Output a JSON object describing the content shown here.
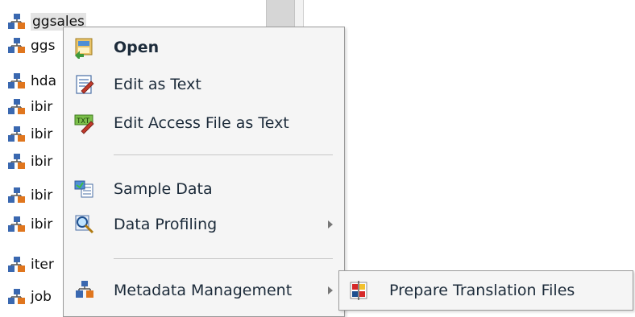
{
  "tree": {
    "items": [
      {
        "label": "ggsales",
        "selected": true
      },
      {
        "label": "ggs"
      },
      {
        "label": "hda"
      },
      {
        "label": "ibir"
      },
      {
        "label": "ibir"
      },
      {
        "label": "ibir"
      },
      {
        "label": "ibir"
      },
      {
        "label": "ibir"
      },
      {
        "label": "iter"
      },
      {
        "label": "job"
      }
    ]
  },
  "context_menu": {
    "items": [
      {
        "label": "Open",
        "icon": "open-icon",
        "bold": true
      },
      {
        "label": "Edit as Text",
        "icon": "edit-text-icon"
      },
      {
        "label": "Edit Access File as Text",
        "icon": "edit-access-file-icon"
      },
      {
        "label": "Sample Data",
        "icon": "sample-data-icon"
      },
      {
        "label": "Data Profiling",
        "icon": "data-profiling-icon",
        "has_submenu": true
      },
      {
        "label": "Metadata Management",
        "icon": "metadata-icon",
        "has_submenu": true
      }
    ]
  },
  "submenu": {
    "items": [
      {
        "label": "Prepare Translation Files",
        "icon": "translation-icon"
      }
    ]
  },
  "colors": {
    "menu_bg": "#f5f5f5",
    "menu_border": "#9a9a9a",
    "text": "#1c2b3a",
    "selected_bg": "#e4e4e4"
  }
}
